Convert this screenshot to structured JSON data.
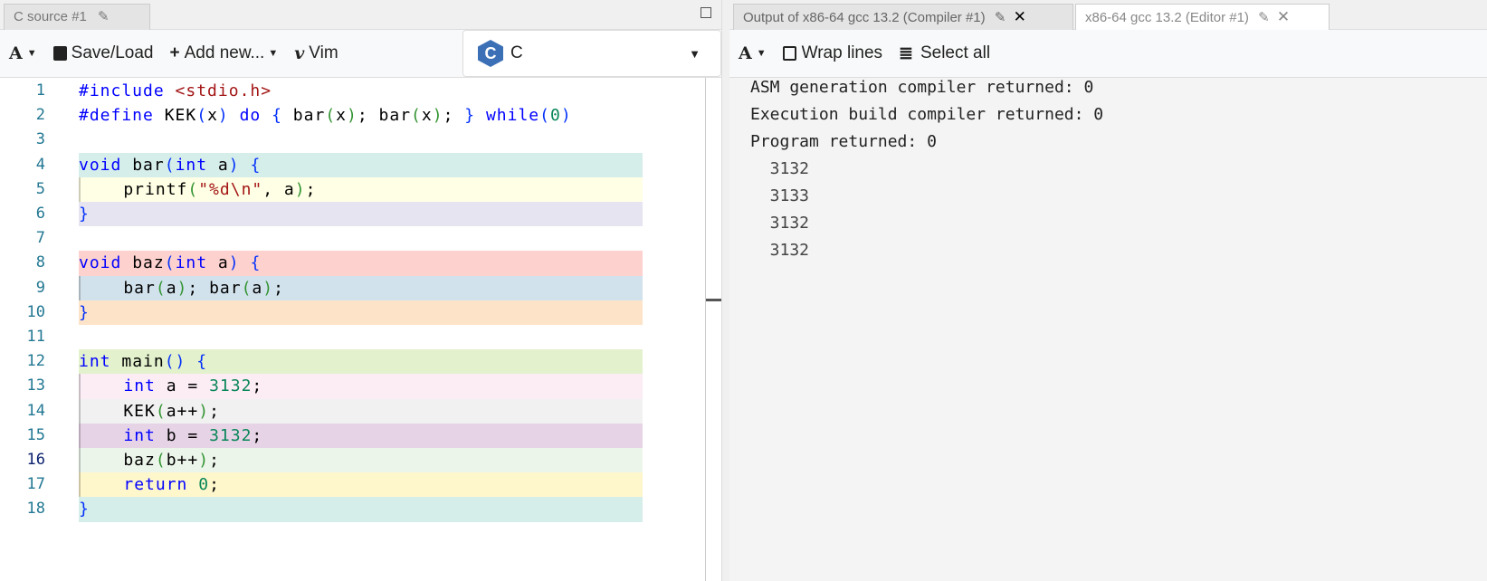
{
  "left_pane": {
    "tab_title": "C source #1",
    "toolbar": {
      "font_label": "A",
      "save_load": "Save/Load",
      "add_new": "Add new...",
      "vim": "Vim",
      "language": "C"
    },
    "code_lines": [
      [
        [
          "kw",
          "#include "
        ],
        [
          "str",
          "<stdio.h>"
        ]
      ],
      [
        [
          "kw",
          "#define "
        ],
        [
          "id",
          "KEK"
        ],
        [
          "b1",
          "("
        ],
        [
          "id",
          "x"
        ],
        [
          "b1",
          ")"
        ],
        [
          "id",
          " "
        ],
        [
          "kw",
          "do"
        ],
        [
          "id",
          " "
        ],
        [
          "b1",
          "{"
        ],
        [
          "id",
          " bar"
        ],
        [
          "b2",
          "("
        ],
        [
          "id",
          "x"
        ],
        [
          "b2",
          ")"
        ],
        [
          "id",
          "; bar"
        ],
        [
          "b2",
          "("
        ],
        [
          "id",
          "x"
        ],
        [
          "b2",
          ")"
        ],
        [
          "id",
          "; "
        ],
        [
          "b1",
          "}"
        ],
        [
          "id",
          " "
        ],
        [
          "kw",
          "while"
        ],
        [
          "b1",
          "("
        ],
        [
          "num",
          "0"
        ],
        [
          "b1",
          ")"
        ]
      ],
      [],
      [
        [
          "kw",
          "void"
        ],
        [
          "id",
          " bar"
        ],
        [
          "b1",
          "("
        ],
        [
          "kw",
          "int"
        ],
        [
          "id",
          " a"
        ],
        [
          "b1",
          ")"
        ],
        [
          "id",
          " "
        ],
        [
          "b1",
          "{"
        ]
      ],
      [
        [
          "id",
          "    printf"
        ],
        [
          "b2",
          "("
        ],
        [
          "str",
          "\"%d\\n\""
        ],
        [
          "id",
          ", a"
        ],
        [
          "b2",
          ")"
        ],
        [
          "id",
          ";"
        ]
      ],
      [
        [
          "b1",
          "}"
        ]
      ],
      [],
      [
        [
          "kw",
          "void"
        ],
        [
          "id",
          " baz"
        ],
        [
          "b1",
          "("
        ],
        [
          "kw",
          "int"
        ],
        [
          "id",
          " a"
        ],
        [
          "b1",
          ")"
        ],
        [
          "id",
          " "
        ],
        [
          "b1",
          "{"
        ]
      ],
      [
        [
          "id",
          "    bar"
        ],
        [
          "b2",
          "("
        ],
        [
          "id",
          "a"
        ],
        [
          "b2",
          ")"
        ],
        [
          "id",
          "; bar"
        ],
        [
          "b2",
          "("
        ],
        [
          "id",
          "a"
        ],
        [
          "b2",
          ")"
        ],
        [
          "id",
          ";"
        ]
      ],
      [
        [
          "b1",
          "}"
        ]
      ],
      [],
      [
        [
          "kw",
          "int"
        ],
        [
          "id",
          " main"
        ],
        [
          "b1",
          "()"
        ],
        [
          "id",
          " "
        ],
        [
          "b1",
          "{"
        ]
      ],
      [
        [
          "id",
          "    "
        ],
        [
          "kw",
          "int"
        ],
        [
          "id",
          " a = "
        ],
        [
          "num",
          "3132"
        ],
        [
          "id",
          ";"
        ]
      ],
      [
        [
          "id",
          "    KEK"
        ],
        [
          "b2",
          "("
        ],
        [
          "id",
          "a++"
        ],
        [
          "b2",
          ")"
        ],
        [
          "id",
          ";"
        ]
      ],
      [
        [
          "id",
          "    "
        ],
        [
          "kw",
          "int"
        ],
        [
          "id",
          " b = "
        ],
        [
          "num",
          "3132"
        ],
        [
          "id",
          ";"
        ]
      ],
      [
        [
          "id",
          "    baz"
        ],
        [
          "b2",
          "("
        ],
        [
          "id",
          "b++"
        ],
        [
          "b2",
          ")"
        ],
        [
          "id",
          ";"
        ]
      ],
      [
        [
          "id",
          "    "
        ],
        [
          "kw",
          "return"
        ],
        [
          "id",
          " "
        ],
        [
          "num",
          "0"
        ],
        [
          "id",
          ";"
        ]
      ],
      [
        [
          "b1",
          "}"
        ]
      ]
    ],
    "line_numbers": [
      "1",
      "2",
      "3",
      "4",
      "5",
      "6",
      "7",
      "8",
      "9",
      "10",
      "11",
      "12",
      "13",
      "14",
      "15",
      "16",
      "17",
      "18"
    ],
    "line_colors": [
      "",
      "",
      "",
      "#d5eeea",
      "#ffffe5",
      "#e6e4f1",
      "",
      "#fdd2ce",
      "#d2e2ec",
      "#fde3c8",
      "",
      "#e3f1cc",
      "#fcedf5",
      "#f1f1f1",
      "#e7d3e6",
      "#ecf5ea",
      "#fef7cc",
      "#d5eeea"
    ]
  },
  "right_pane": {
    "tabs": [
      {
        "label": "Output of x86-64 gcc 13.2 (Compiler #1)"
      },
      {
        "label": "x86-64 gcc 13.2 (Editor #1)"
      }
    ],
    "toolbar": {
      "font_label": "A",
      "wrap_lines": "Wrap lines",
      "select_all": "Select all"
    },
    "output": [
      "ASM generation compiler returned: 0",
      "Execution build compiler returned: 0",
      "Program returned: 0",
      "  3132",
      "  3133",
      "  3132",
      "  3132"
    ]
  }
}
